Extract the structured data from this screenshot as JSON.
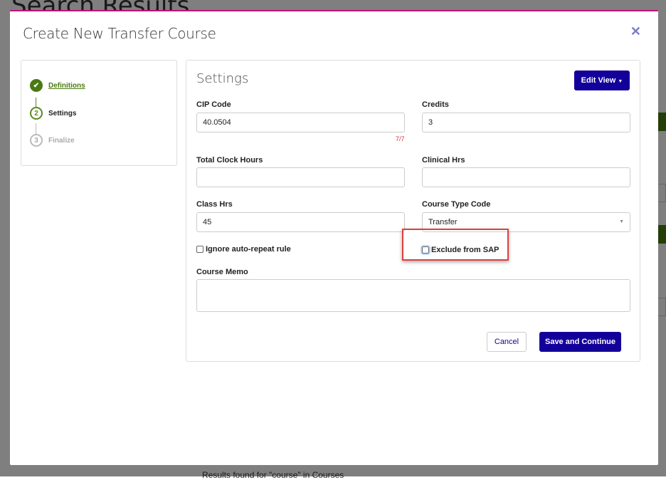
{
  "background": {
    "title": "Search Results",
    "results_text": "Results found for \"course\" in Courses"
  },
  "modal": {
    "title": "Create New Transfer Course",
    "close_icon": "close-icon"
  },
  "steps": [
    {
      "number": "1",
      "label": "Definitions",
      "state": "complete"
    },
    {
      "number": "2",
      "label": "Settings",
      "state": "current"
    },
    {
      "number": "3",
      "label": "Finalize",
      "state": "pending"
    }
  ],
  "settings": {
    "title": "Settings",
    "edit_view_label": "Edit View",
    "fields": {
      "cip_code": {
        "label": "CIP Code",
        "value": "40.0504",
        "counter": "7/7"
      },
      "credits": {
        "label": "Credits",
        "value": "3"
      },
      "total_clock_hours": {
        "label": "Total Clock Hours",
        "value": ""
      },
      "clinical_hrs": {
        "label": "Clinical Hrs",
        "value": ""
      },
      "class_hrs": {
        "label": "Class Hrs",
        "value": "45"
      },
      "course_type_code": {
        "label": "Course Type Code",
        "value": "Transfer"
      },
      "ignore_auto_repeat": {
        "label": "Ignore auto-repeat rule",
        "checked": false
      },
      "exclude_from_sap": {
        "label": "Exclude from SAP",
        "checked": false
      },
      "course_memo": {
        "label": "Course Memo",
        "value": ""
      }
    },
    "cancel_label": "Cancel",
    "save_label": "Save and Continue"
  },
  "colors": {
    "accent": "#13009a",
    "success": "#5a8a1c",
    "top_border": "#c0107a",
    "highlight": "#e0403f",
    "counter": "#e03040"
  }
}
